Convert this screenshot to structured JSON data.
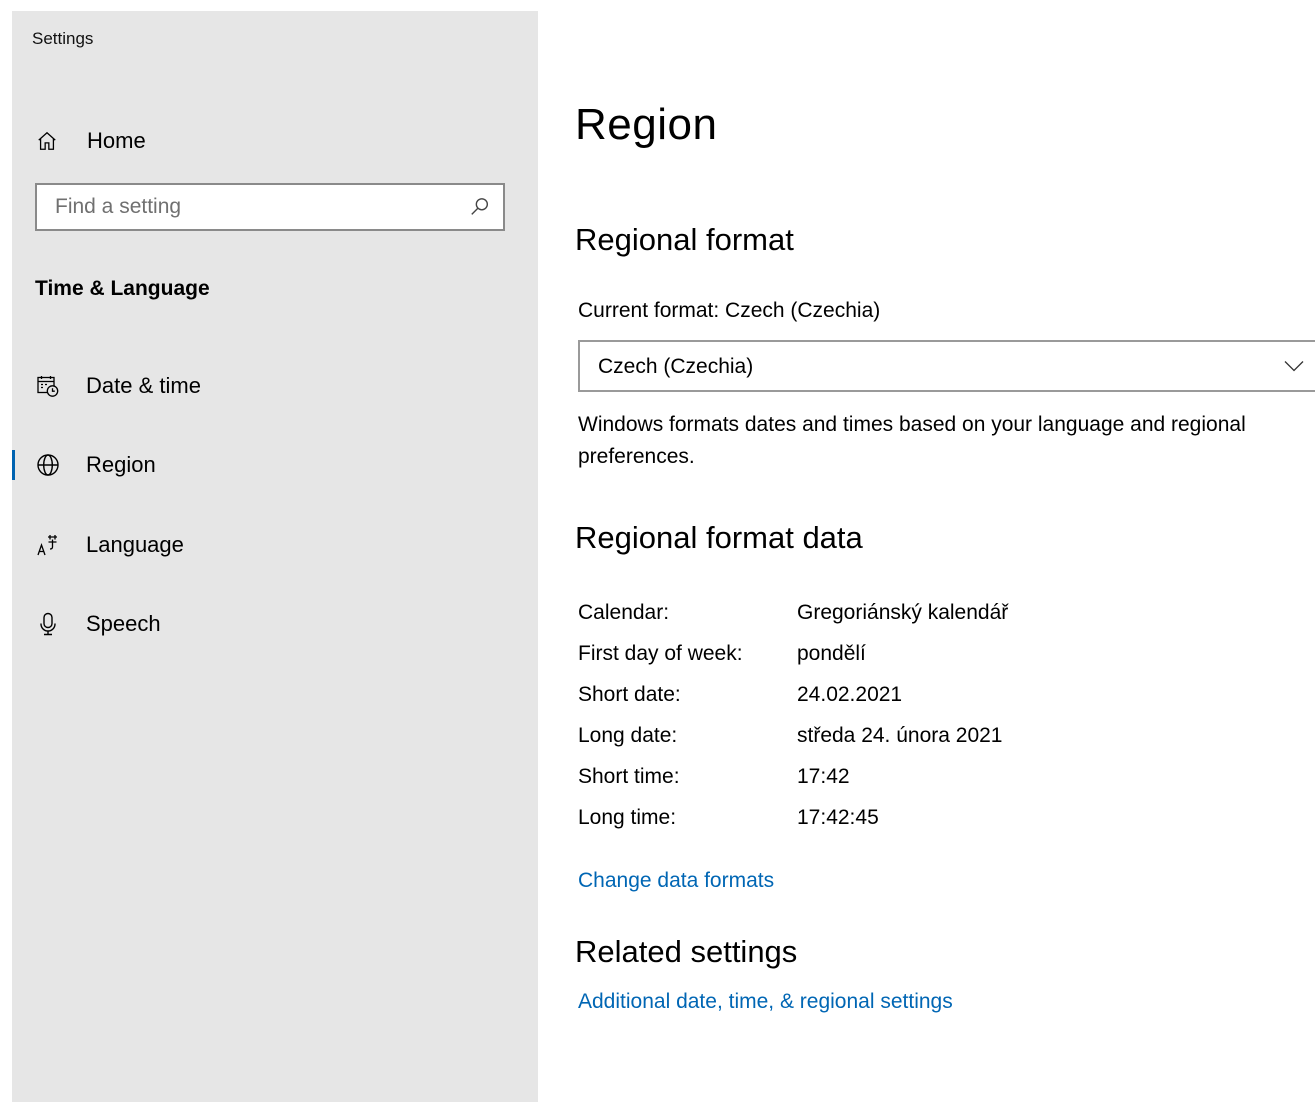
{
  "app": {
    "title": "Settings"
  },
  "sidebar": {
    "home_label": "Home",
    "search_placeholder": "Find a setting",
    "section_title": "Time & Language",
    "items": [
      {
        "label": "Date & time",
        "icon": "calendar-clock-icon",
        "selected": false
      },
      {
        "label": "Region",
        "icon": "globe-icon",
        "selected": true
      },
      {
        "label": "Language",
        "icon": "language-icon",
        "selected": false
      },
      {
        "label": "Speech",
        "icon": "microphone-icon",
        "selected": false
      }
    ]
  },
  "main": {
    "title": "Region",
    "regional_format": {
      "heading": "Regional format",
      "current_label": "Current format: Czech (Czechia)",
      "dropdown_value": "Czech (Czechia)",
      "description": "Windows formats dates and times based on your language and regional preferences."
    },
    "format_data": {
      "heading": "Regional format data",
      "rows": [
        {
          "key": "Calendar:",
          "value": "Gregoriánský kalendář"
        },
        {
          "key": "First day of week:",
          "value": "pondělí"
        },
        {
          "key": "Short date:",
          "value": "24.02.2021"
        },
        {
          "key": "Long date:",
          "value": "středa 24. února 2021"
        },
        {
          "key": "Short time:",
          "value": "17:42"
        },
        {
          "key": "Long time:",
          "value": "17:42:45"
        }
      ],
      "change_link": "Change data formats"
    },
    "related": {
      "heading": "Related settings",
      "link": "Additional date, time, & regional settings"
    }
  },
  "colors": {
    "accent": "#0063b1",
    "link": "#0066b4",
    "sidebar_bg": "#e6e6e6"
  }
}
